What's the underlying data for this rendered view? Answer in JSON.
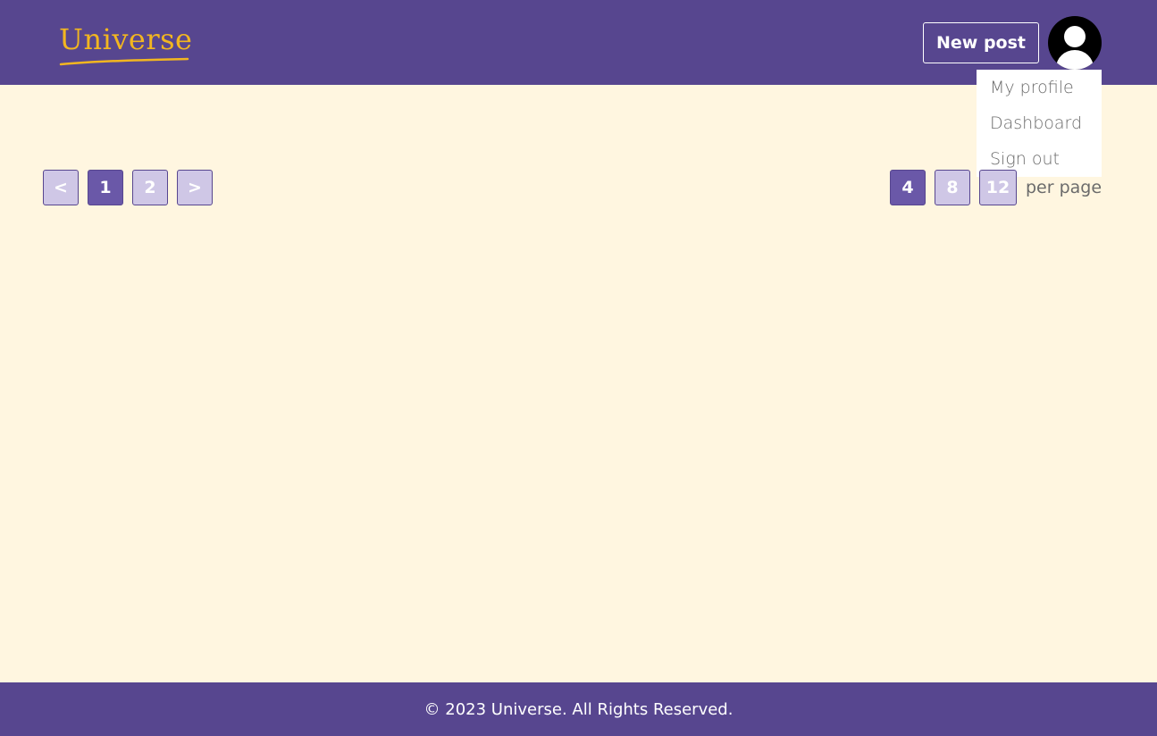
{
  "header": {
    "logo_text": "Universe",
    "new_post_label": "New post"
  },
  "user_menu": {
    "items": [
      {
        "label": "My profile"
      },
      {
        "label": "Dashboard"
      },
      {
        "label": "Sign out"
      }
    ]
  },
  "pagination": {
    "prev_label": "<",
    "next_label": ">",
    "pages": [
      {
        "label": "1",
        "active": true
      },
      {
        "label": "2",
        "active": false
      }
    ]
  },
  "per_page": {
    "options": [
      {
        "label": "4",
        "active": true
      },
      {
        "label": "8",
        "active": false
      },
      {
        "label": "12",
        "active": false
      }
    ],
    "suffix": "per page"
  },
  "footer": {
    "copyright": "© 2023 Universe. All Rights Reserved."
  },
  "colors": {
    "brand": "#57468f",
    "accent_active": "#6a58a8",
    "inactive_button": "#cfc7e6",
    "logo": "#f2b620",
    "background": "#fff6e0"
  },
  "icons": {
    "avatar": "user-avatar-icon"
  }
}
